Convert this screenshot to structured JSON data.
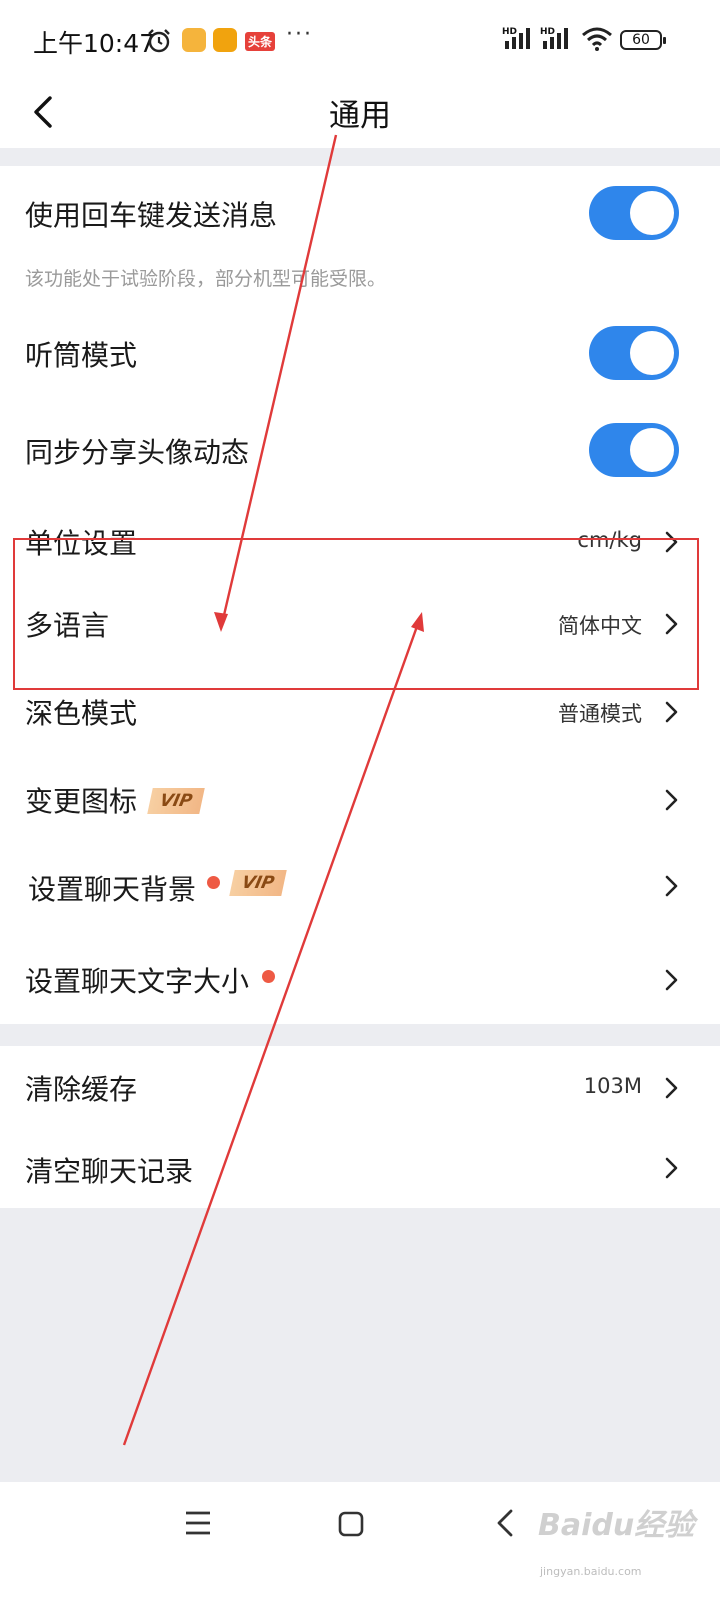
{
  "status_bar": {
    "time": "上午10:47",
    "app_badge": "头条",
    "more": "···",
    "hd1": "HD",
    "hd2": "HD",
    "battery": "60"
  },
  "header": {
    "title": "通用"
  },
  "settings": {
    "enter_send": {
      "label": "使用回车键发送消息",
      "hint": "该功能处于试验阶段，部分机型可能受限。",
      "enabled": true
    },
    "earpiece": {
      "label": "听筒模式",
      "enabled": true
    },
    "sync_avatar": {
      "label": "同步分享头像动态",
      "enabled": true
    },
    "units": {
      "label": "单位设置",
      "value": "cm/kg"
    },
    "language": {
      "label": "多语言",
      "value": "简体中文"
    },
    "dark_mode": {
      "label": "深色模式",
      "value": "普通模式"
    },
    "change_icon": {
      "label": "变更图标",
      "badge": "VIP"
    },
    "chat_bg": {
      "label": "设置聊天背景",
      "badge": "VIP"
    },
    "font_size": {
      "label": "设置聊天文字大小"
    },
    "clear_cache": {
      "label": "清除缓存",
      "value": "103M"
    },
    "clear_history": {
      "label": "清空聊天记录"
    }
  },
  "watermark": {
    "logo": "Baidu经验",
    "url": "jingyan.baidu.com"
  },
  "colors": {
    "toggle_on": "#2F86EB",
    "annotation": "#E03A3A",
    "vip_bg": "#F2B786",
    "dot": "#EE5A44"
  }
}
